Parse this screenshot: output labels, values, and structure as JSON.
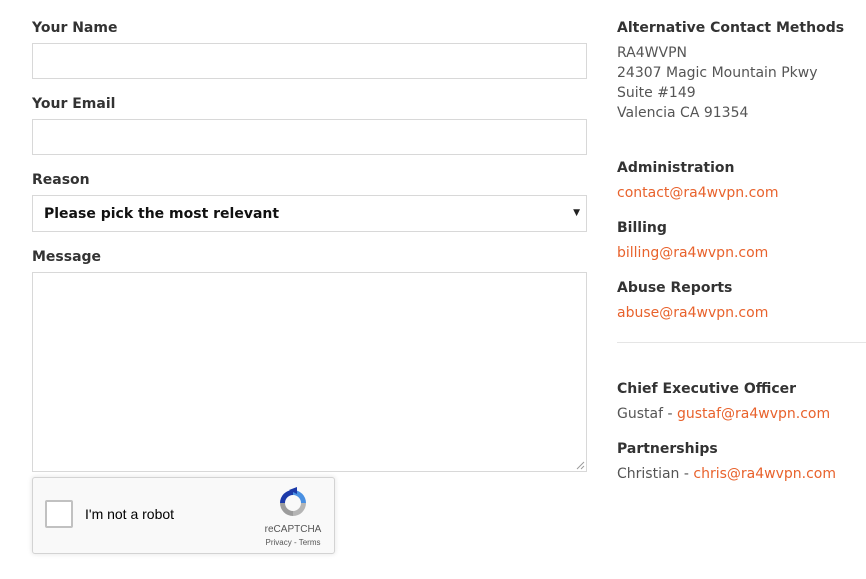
{
  "form": {
    "name_label": "Your Name",
    "name_value": "",
    "email_label": "Your Email",
    "email_value": "",
    "reason_label": "Reason",
    "reason_selected": "Please pick the most relevant",
    "message_label": "Message",
    "message_value": ""
  },
  "recaptcha": {
    "checkbox_label": "I'm not a robot",
    "brand": "reCAPTCHA",
    "privacy": "Privacy",
    "separator": " - ",
    "terms": "Terms"
  },
  "contact": {
    "alt_heading": "Alternative Contact Methods",
    "address": [
      "RA4WVPN",
      "24307 Magic Mountain Pkwy",
      "Suite #149",
      "Valencia CA 91354"
    ],
    "administration": {
      "heading": "Administration",
      "email": "contact@ra4wvpn.com"
    },
    "billing": {
      "heading": "Billing",
      "email": "billing@ra4wvpn.com"
    },
    "abuse": {
      "heading": "Abuse Reports",
      "email": "abuse@ra4wvpn.com"
    },
    "ceo": {
      "heading": "Chief Executive Officer",
      "person": "Gustaf - ",
      "email": "gustaf@ra4wvpn.com"
    },
    "partnerships": {
      "heading": "Partnerships",
      "person": "Christian - ",
      "email": "chris@ra4wvpn.com"
    }
  },
  "colors": {
    "link": "#e8622c",
    "heading": "#333333",
    "border": "#d8d8d8"
  }
}
